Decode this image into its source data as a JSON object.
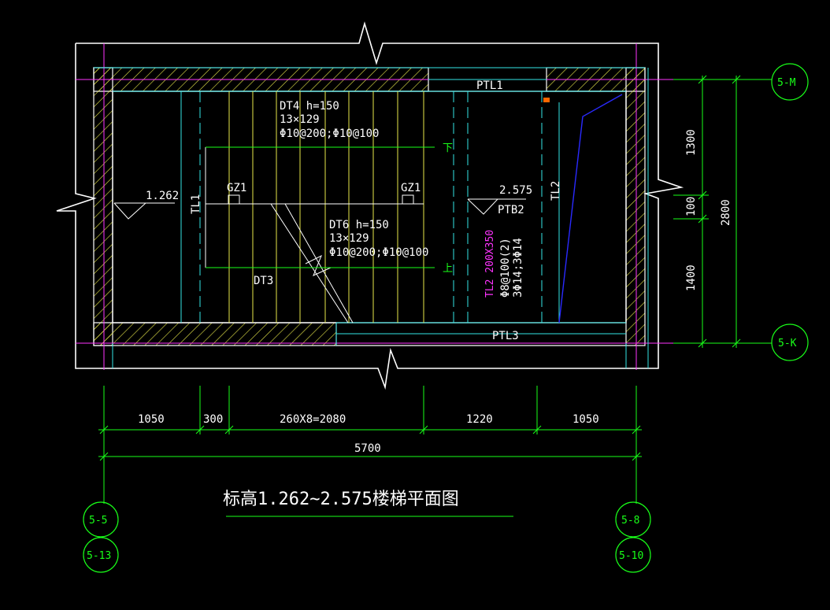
{
  "title": "标高1.262~2.575楼梯平面图",
  "grid_axes": {
    "top_right": "5-M",
    "bottom_right": "5-K",
    "left_primary": "5-5",
    "left_secondary": "5-13",
    "right_primary": "5-8",
    "right_secondary": "5-10"
  },
  "dimensions": {
    "seg1": "1050",
    "seg2": "300",
    "seg3": "260X8=2080",
    "seg4": "1220",
    "seg5": "1050",
    "total": "5700",
    "v_top": "1300",
    "v_mid": "100",
    "v_bottom": "1400",
    "v_total": "2800"
  },
  "labels": {
    "ptl1": "PTL1",
    "ptl3": "PTL3",
    "tl1": "TL1",
    "tl2": "TL2",
    "gz1_left": "GZ1",
    "gz1_right": "GZ1",
    "dt3": "DT3",
    "ptb2": "PTB2",
    "elev_left": "1.262",
    "elev_right": "2.575",
    "dt4_line1": "DT4  h=150",
    "dt4_line2": "13×129",
    "dt4_line3": "Φ10@200;Φ10@100",
    "dt6_line1": "DT6  h=150",
    "dt6_line2": "13×129",
    "dt6_line3": "Φ10@200;Φ10@100",
    "down": "下",
    "up": "上",
    "tl2_beam_line1": "TL2 200X350",
    "tl2_beam_line2": "Φ8@100(2)",
    "tl2_beam_line3": "3Φ14;3Φ14"
  },
  "colors": {
    "background": "#000000",
    "wall": "#ffffff",
    "hatch": "#e8e84a",
    "stair_line": "#e8e84a",
    "grid_line": "#ff33ff",
    "dimension": "#19ff19",
    "axis_circle": "#19ff19",
    "cyan": "#33e6e6",
    "blue": "#2a2aff"
  }
}
